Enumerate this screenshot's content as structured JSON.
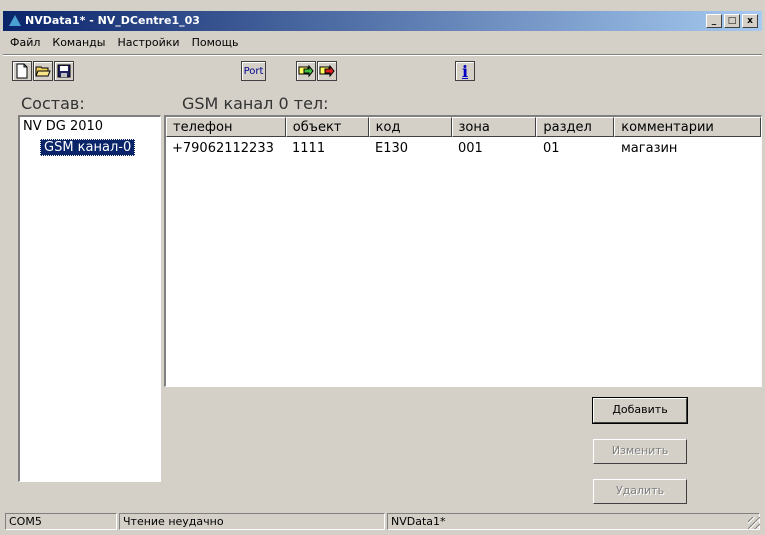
{
  "window": {
    "title": "NVData1* - NV_DCentre1_03",
    "controls": {
      "minimize": "_",
      "maximize": "□",
      "close": "x"
    }
  },
  "menu": [
    "Файл",
    "Команды",
    "Настройки",
    "Помощь"
  ],
  "toolbar": {
    "new_icon": "new-file-icon",
    "open_icon": "open-folder-icon",
    "save_icon": "save-icon",
    "port_label": "Port",
    "info_label": "i"
  },
  "left_panel": {
    "title": "Состав:",
    "tree_root": "NV DG 2010",
    "tree_child": "GSM канал-0"
  },
  "right_panel": {
    "title": "GSM канал 0 тел:",
    "columns": [
      "телефон",
      "объект",
      "код",
      "зона",
      "раздел",
      "комментарии"
    ],
    "rows": [
      [
        "+79062112233",
        "1111",
        "E130",
        "001",
        "01",
        "магазин"
      ]
    ]
  },
  "buttons": {
    "add": "Добавить",
    "edit": "Изменить",
    "delete": "Удалить"
  },
  "status": {
    "port": "COM5",
    "message": "Чтение неудачно",
    "file": "NVData1*"
  },
  "colors": {
    "title_bar": "#0a246a",
    "selection": "#0a246a",
    "face": "#d4d0c8"
  }
}
